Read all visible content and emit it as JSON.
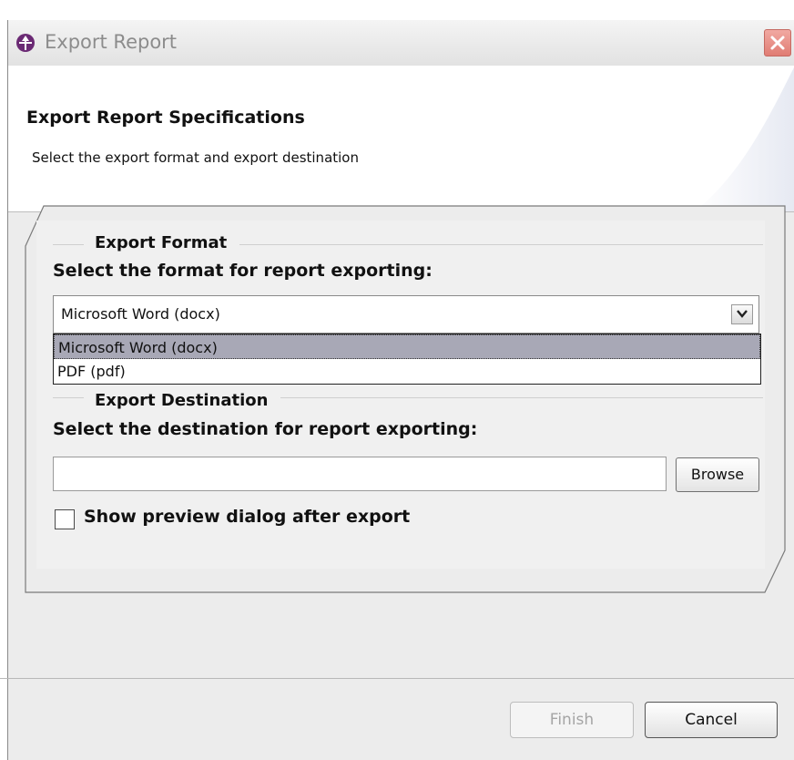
{
  "window": {
    "title": "Export Report",
    "close_icon": "close-icon",
    "app_icon": "eclipse-report-icon"
  },
  "header": {
    "title": "Export Report Specifications",
    "subtitle": "Select the export format and export destination"
  },
  "format_group": {
    "legend": "Export Format",
    "label": "Select the format for report exporting:",
    "selected": "Microsoft Word (docx)",
    "options": [
      "Microsoft Word (docx)",
      "PDF (pdf)"
    ]
  },
  "destination_group": {
    "legend": "Export Destination",
    "label": "Select the destination for report exporting:",
    "path_value": "",
    "browse_label": "Browse"
  },
  "preview": {
    "label": "Show preview dialog after export",
    "checked": false
  },
  "buttons": {
    "finish": "Finish",
    "cancel": "Cancel"
  },
  "colors": {
    "selection": "#a8a8b6",
    "close_button": "#e07c73",
    "dialog_bg": "#ececec"
  }
}
